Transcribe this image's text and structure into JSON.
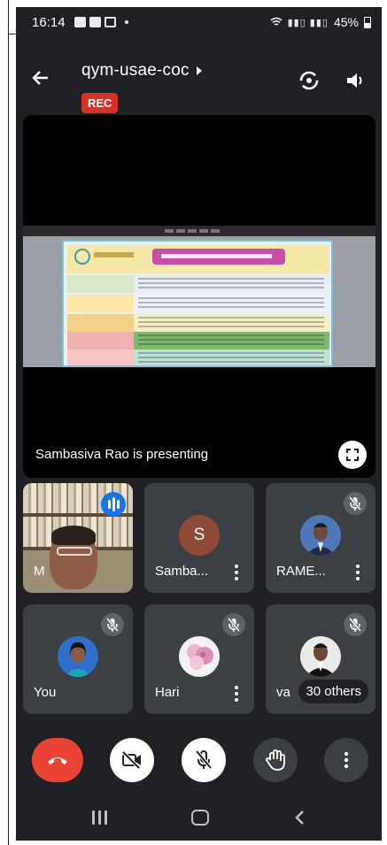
{
  "status_bar": {
    "time": "16:14",
    "battery": "45%"
  },
  "header": {
    "meeting_code": "qym-usae-coc",
    "recording_badge": "REC"
  },
  "presentation": {
    "presenter_label": "Sambasiva Rao is presenting"
  },
  "tiles": [
    {
      "name": "M",
      "muted": false,
      "speaking": true
    },
    {
      "name": "Samba...",
      "avatar_initial": "S",
      "avatar_color": "#8d4b37",
      "muted": true
    },
    {
      "name": "RAME...",
      "muted": true
    },
    {
      "name": "You",
      "muted": true
    },
    {
      "name": "Hari",
      "muted": true
    },
    {
      "name": "va",
      "muted": true,
      "others_badge": "30 others"
    }
  ],
  "controls": [
    {
      "name": "leave-call",
      "icon": "phone-hangup-icon",
      "color": "#ea4335"
    },
    {
      "name": "camera-off",
      "icon": "video-off-icon"
    },
    {
      "name": "mic-off",
      "icon": "mic-off-icon"
    },
    {
      "name": "raise-hand",
      "icon": "hand-icon"
    },
    {
      "name": "more-options",
      "icon": "more-vert-icon"
    }
  ],
  "colors": {
    "background": "#202124",
    "tile": "#3c4043",
    "accent_red": "#d93025",
    "speaking_blue": "#1a73e8"
  }
}
